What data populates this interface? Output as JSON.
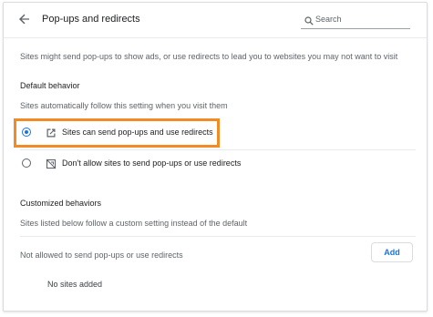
{
  "header": {
    "back_icon": "arrow-back-icon",
    "title": "Pop-ups and redirects",
    "search": {
      "icon": "search-icon",
      "placeholder": "Search",
      "value": ""
    }
  },
  "description": "Sites might send pop-ups to show ads, or use redirects to lead you to websites you may not want to visit",
  "default_behavior": {
    "heading": "Default behavior",
    "subheading": "Sites automatically follow this setting when you visit them",
    "options": [
      {
        "label": "Sites can send pop-ups and use redirects",
        "icon": "open-in-new-icon",
        "selected": true
      },
      {
        "label": "Don't allow sites to send pop-ups or use redirects",
        "icon": "popup-blocked-icon",
        "selected": false
      }
    ],
    "highlight_color": "#f28b24"
  },
  "customized": {
    "heading": "Customized behaviors",
    "subheading": "Sites listed below follow a custom setting instead of the default",
    "not_allowed_label": "Not allowed to send pop-ups or use redirects",
    "add_label": "Add",
    "empty_text": "No sites added"
  },
  "colors": {
    "accent": "#1a73e8",
    "secondary_text": "#5f6368"
  }
}
